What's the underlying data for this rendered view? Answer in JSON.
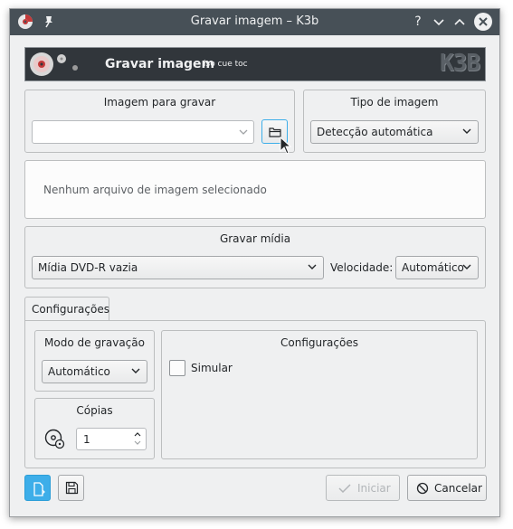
{
  "window": {
    "title": "Gravar imagem – K3b"
  },
  "titlebar": {
    "help_label": "?",
    "menu_icon": "k3b-app-icon",
    "pin_icon": "pin-icon"
  },
  "banner": {
    "title": "Gravar imagem",
    "subtitle": "iso cue toc",
    "logo_text": "K3B"
  },
  "image_group": {
    "title": "Imagem para gravar",
    "path_value": ""
  },
  "image_type": {
    "title": "Tipo de imagem",
    "selected": "Detecção automática"
  },
  "info": {
    "text": "Nenhum arquivo de imagem selecionado"
  },
  "burn_media": {
    "title": "Gravar mídia",
    "device_selected": "Mídia DVD-R vazia",
    "speed_label": "Velocidade:",
    "speed_selected": "Automático"
  },
  "tabs": [
    {
      "label": "Configurações",
      "active": true
    }
  ],
  "write_mode": {
    "title": "Modo de gravação",
    "selected": "Automático"
  },
  "copies": {
    "title": "Cópias",
    "value": "1"
  },
  "settings": {
    "title": "Configurações",
    "simulate_label": "Simular",
    "simulate_checked": false
  },
  "footer": {
    "start_label": "Iniciar",
    "cancel_label": "Cancelar",
    "start_enabled": false
  },
  "colors": {
    "titlebar": "#475057",
    "banner": "#31363b",
    "accent": "#3daee9",
    "background": "#eff0f1"
  }
}
